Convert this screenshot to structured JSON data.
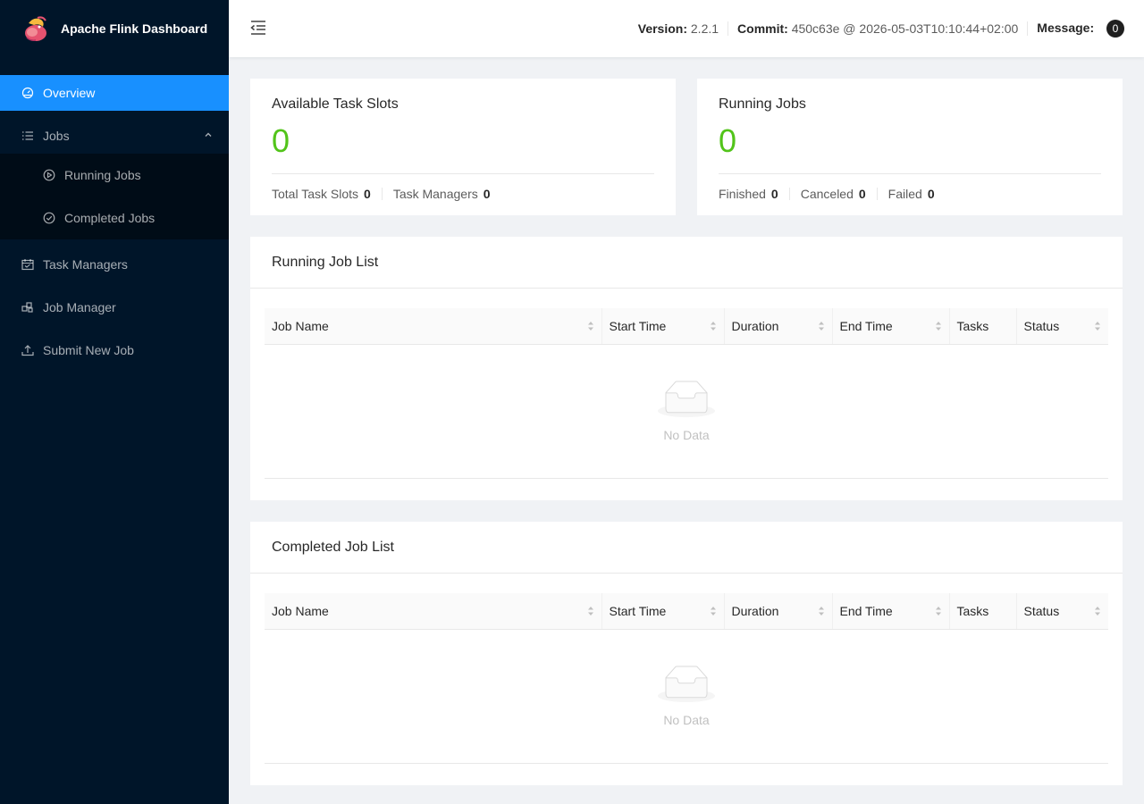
{
  "brand": {
    "title": "Apache Flink Dashboard"
  },
  "sidebar": {
    "items": [
      {
        "label": "Overview",
        "icon": "dashboard-icon"
      },
      {
        "label": "Jobs",
        "icon": "list-icon"
      },
      {
        "label": "Running Jobs",
        "icon": "play-circle-icon"
      },
      {
        "label": "Completed Jobs",
        "icon": "check-circle-icon"
      },
      {
        "label": "Task Managers",
        "icon": "schedule-icon"
      },
      {
        "label": "Job Manager",
        "icon": "cluster-icon"
      },
      {
        "label": "Submit New Job",
        "icon": "upload-icon"
      }
    ]
  },
  "header": {
    "version_label": "Version:",
    "version": "2.2.1",
    "commit_label": "Commit:",
    "commit": "450c63e @ 2026-05-03T10:10:44+02:00",
    "message_label": "Message:",
    "message_count": "0"
  },
  "task_slots": {
    "title": "Available Task Slots",
    "value": "0",
    "total_label": "Total Task Slots",
    "total": "0",
    "tm_label": "Task Managers",
    "tm": "0"
  },
  "running_jobs": {
    "title": "Running Jobs",
    "value": "0",
    "finished_label": "Finished",
    "finished": "0",
    "canceled_label": "Canceled",
    "canceled": "0",
    "failed_label": "Failed",
    "failed": "0"
  },
  "running_list": {
    "title": "Running Job List",
    "columns": [
      "Job Name",
      "Start Time",
      "Duration",
      "End Time",
      "Tasks",
      "Status"
    ],
    "empty": "No Data"
  },
  "completed_list": {
    "title": "Completed Job List",
    "columns": [
      "Job Name",
      "Start Time",
      "Duration",
      "End Time",
      "Tasks",
      "Status"
    ],
    "empty": "No Data"
  },
  "colors": {
    "accent": "#1890ff",
    "sidebar": "#001529",
    "success": "#52c41a"
  }
}
